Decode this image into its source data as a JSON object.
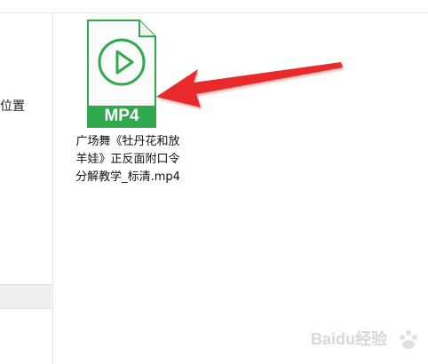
{
  "sidebar": {
    "label": "位置"
  },
  "file": {
    "name": "广场舞《牡丹花和放羊娃》正反面附口令分解教学_标清.mp4",
    "icon_text": "MP4",
    "icon": "mp4-file-icon",
    "accent": "#2fa94b"
  },
  "annotation": {
    "icon": "red-pointer-arrow-icon",
    "color": "#e82929"
  },
  "watermark": {
    "text": "Baidu经验",
    "icon": "baidu-paw-icon"
  }
}
